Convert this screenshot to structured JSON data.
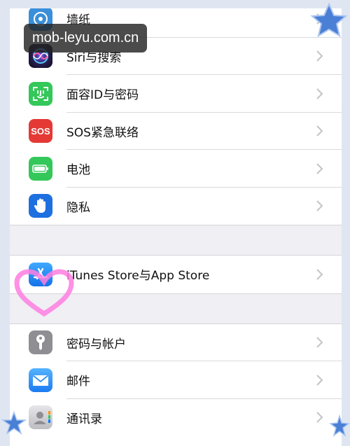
{
  "watermark": {
    "text": "mob-leyu.com.cn"
  },
  "settings": {
    "rows": [
      {
        "label": "墙纸",
        "icon": "wallpaper-icon",
        "color": "#3a8fd9"
      },
      {
        "label": "Siri与搜索",
        "icon": "siri-icon",
        "color": "#1a1a2e"
      },
      {
        "label": "面容ID与密码",
        "icon": "face-id-icon",
        "color": "#34c759"
      },
      {
        "label": "SOS紧急联络",
        "icon": "sos-icon",
        "color": "#e53935",
        "icon_text": "SOS"
      },
      {
        "label": "电池",
        "icon": "battery-icon",
        "color": "#34c759"
      },
      {
        "label": "隐私",
        "icon": "hand-icon",
        "color": "#1e6fe0"
      },
      {
        "label": "iTunes Store与App Store",
        "icon": "app-store-icon",
        "color": "#1e88f2"
      },
      {
        "label": "密码与帐户",
        "icon": "key-icon",
        "color": "#8e8e93"
      },
      {
        "label": "邮件",
        "icon": "mail-icon",
        "color": "#2f8df5"
      },
      {
        "label": "通讯录",
        "icon": "contacts-icon",
        "color": "#c8c8cc"
      }
    ]
  },
  "decorations": {
    "star_color": "#4a7fd6",
    "heart_color": "#ff7ee0"
  }
}
